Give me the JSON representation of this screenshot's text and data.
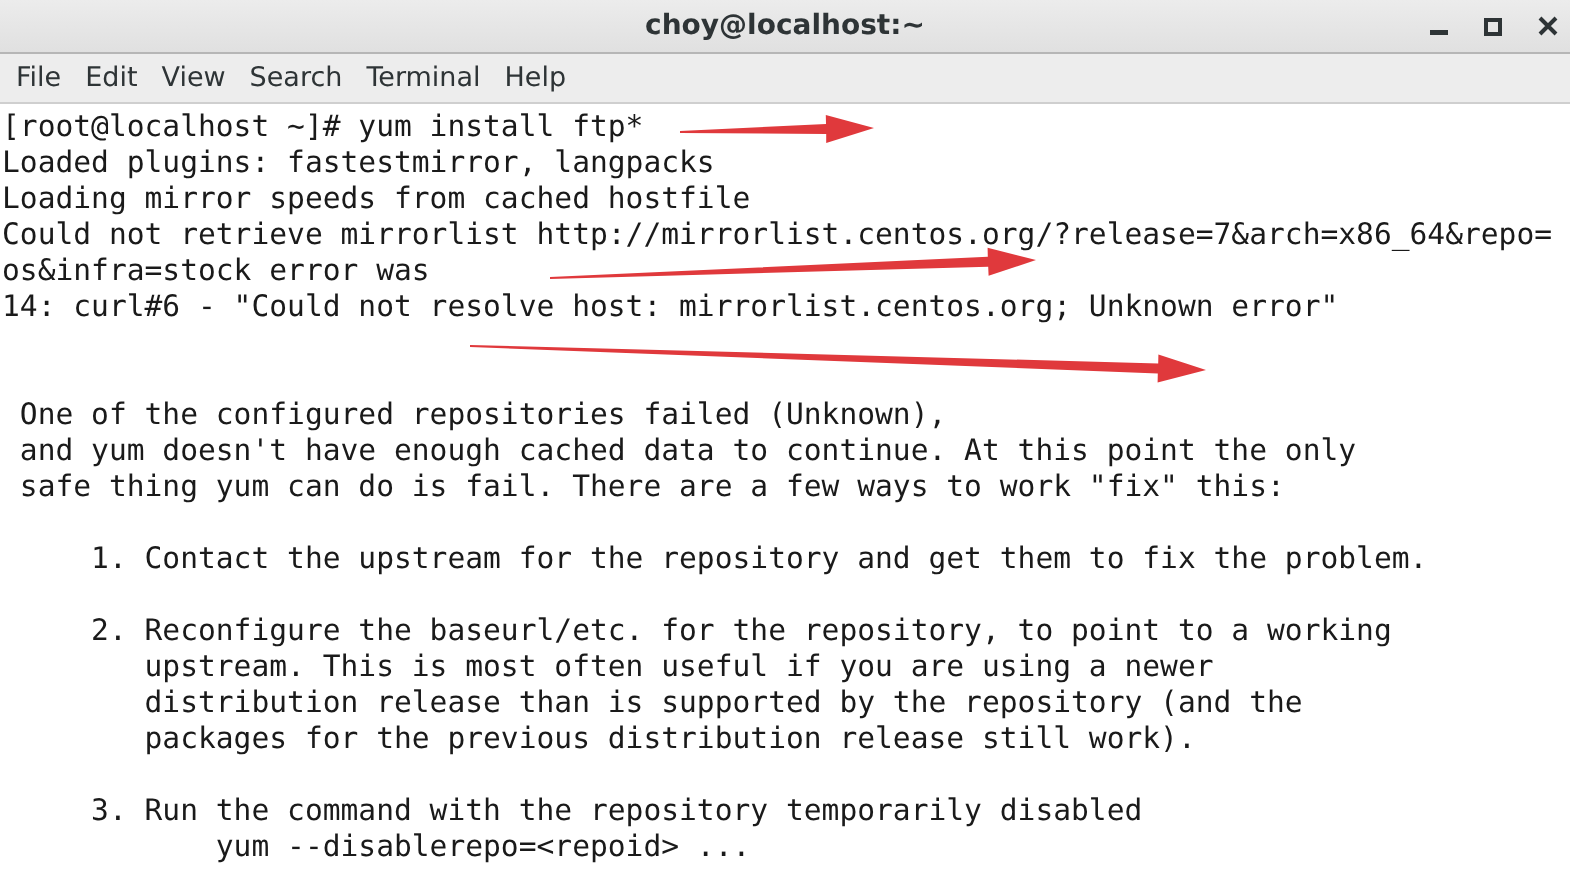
{
  "window": {
    "title": "choy@localhost:~"
  },
  "menu": [
    "File",
    "Edit",
    "View",
    "Search",
    "Terminal",
    "Help"
  ],
  "terminal": {
    "blocks": [
      {
        "lines": [
          "[root@localhost ~]# yum install ftp*",
          "Loaded plugins: fastestmirror, langpacks",
          "Loading mirror speeds from cached hostfile",
          "Could not retrieve mirrorlist http://mirrorlist.centos.org/?release=7&arch=x86_64&repo=",
          "os&infra=stock error was",
          "14: curl#6 - \"Could not resolve host: mirrorlist.centos.org; Unknown error\""
        ]
      },
      {
        "lines": [
          " One of the configured repositories failed (Unknown),",
          " and yum doesn't have enough cached data to continue. At this point the only",
          " safe thing yum can do is fail. There are a few ways to work \"fix\" this:"
        ]
      },
      {
        "lines": [
          "     1. Contact the upstream for the repository and get them to fix the problem."
        ]
      },
      {
        "lines": [
          "     2. Reconfigure the baseurl/etc. for the repository, to point to a working",
          "        upstream. This is most often useful if you are using a newer",
          "        distribution release than is supported by the repository (and the",
          "        packages for the previous distribution release still work)."
        ]
      },
      {
        "lines": [
          "     3. Run the command with the repository temporarily disabled",
          "            yum --disablerepo=<repoid> ..."
        ]
      }
    ]
  }
}
